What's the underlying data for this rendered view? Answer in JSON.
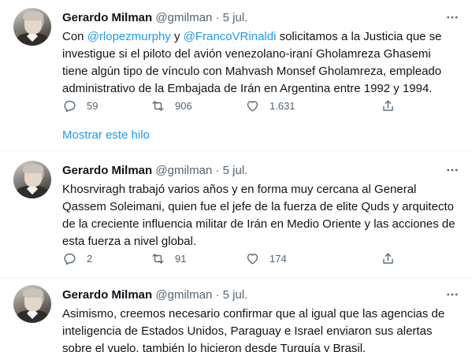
{
  "tweets": [
    {
      "author_name": "Gerardo Milman",
      "handle": "@gmilman",
      "separator": "·",
      "date": "5 jul.",
      "text_segments": [
        {
          "text": "Con ",
          "mention": false
        },
        {
          "text": "@rlopezmurphy",
          "mention": true
        },
        {
          "text": " y ",
          "mention": false
        },
        {
          "text": "@FrancoVRinaldi",
          "mention": true
        },
        {
          "text": " solicitamos a la Justicia que se investigue si el piloto del avión venezolano-iraní Gholamreza Ghasemi tiene algún tipo de vínculo con Mahvash Monsef Gholamreza, empleado administrativo de la Embajada de Irán en Argentina entre 1992 y 1994.",
          "mention": false
        }
      ],
      "replies": "59",
      "retweets": "906",
      "likes": "1.631"
    },
    {
      "author_name": "Gerardo Milman",
      "handle": "@gmilman",
      "separator": "·",
      "date": "5 jul.",
      "text_segments": [
        {
          "text": "Khosrviragh trabajó varios años y en forma muy cercana al General Qassem Soleimani, quien fue el jefe de la fuerza de elite Quds y arquitecto de la creciente influencia militar de Irán en Medio Oriente y las acciones de esta fuerza a nivel global.",
          "mention": false
        }
      ],
      "replies": "2",
      "retweets": "91",
      "likes": "174"
    },
    {
      "author_name": "Gerardo Milman",
      "handle": "@gmilman",
      "separator": "·",
      "date": "5 jul.",
      "text_segments": [
        {
          "text": "Asimismo, creemos necesario confirmar que al igual que las agencias de inteligencia de Estados Unidos, Paraguay e Israel enviaron sus alertas sobre el vuelo, también lo hicieron desde Turquía y Brasil.",
          "mention": false
        }
      ]
    }
  ],
  "show_thread_label": "Mostrar este hilo",
  "icons": {
    "more": "more-options-icon",
    "reply": "reply-icon",
    "retweet": "retweet-icon",
    "like": "like-icon",
    "share": "share-icon"
  },
  "colors": {
    "link": "#1d9bf0",
    "text": "#0f1419",
    "secondary": "#536471"
  }
}
